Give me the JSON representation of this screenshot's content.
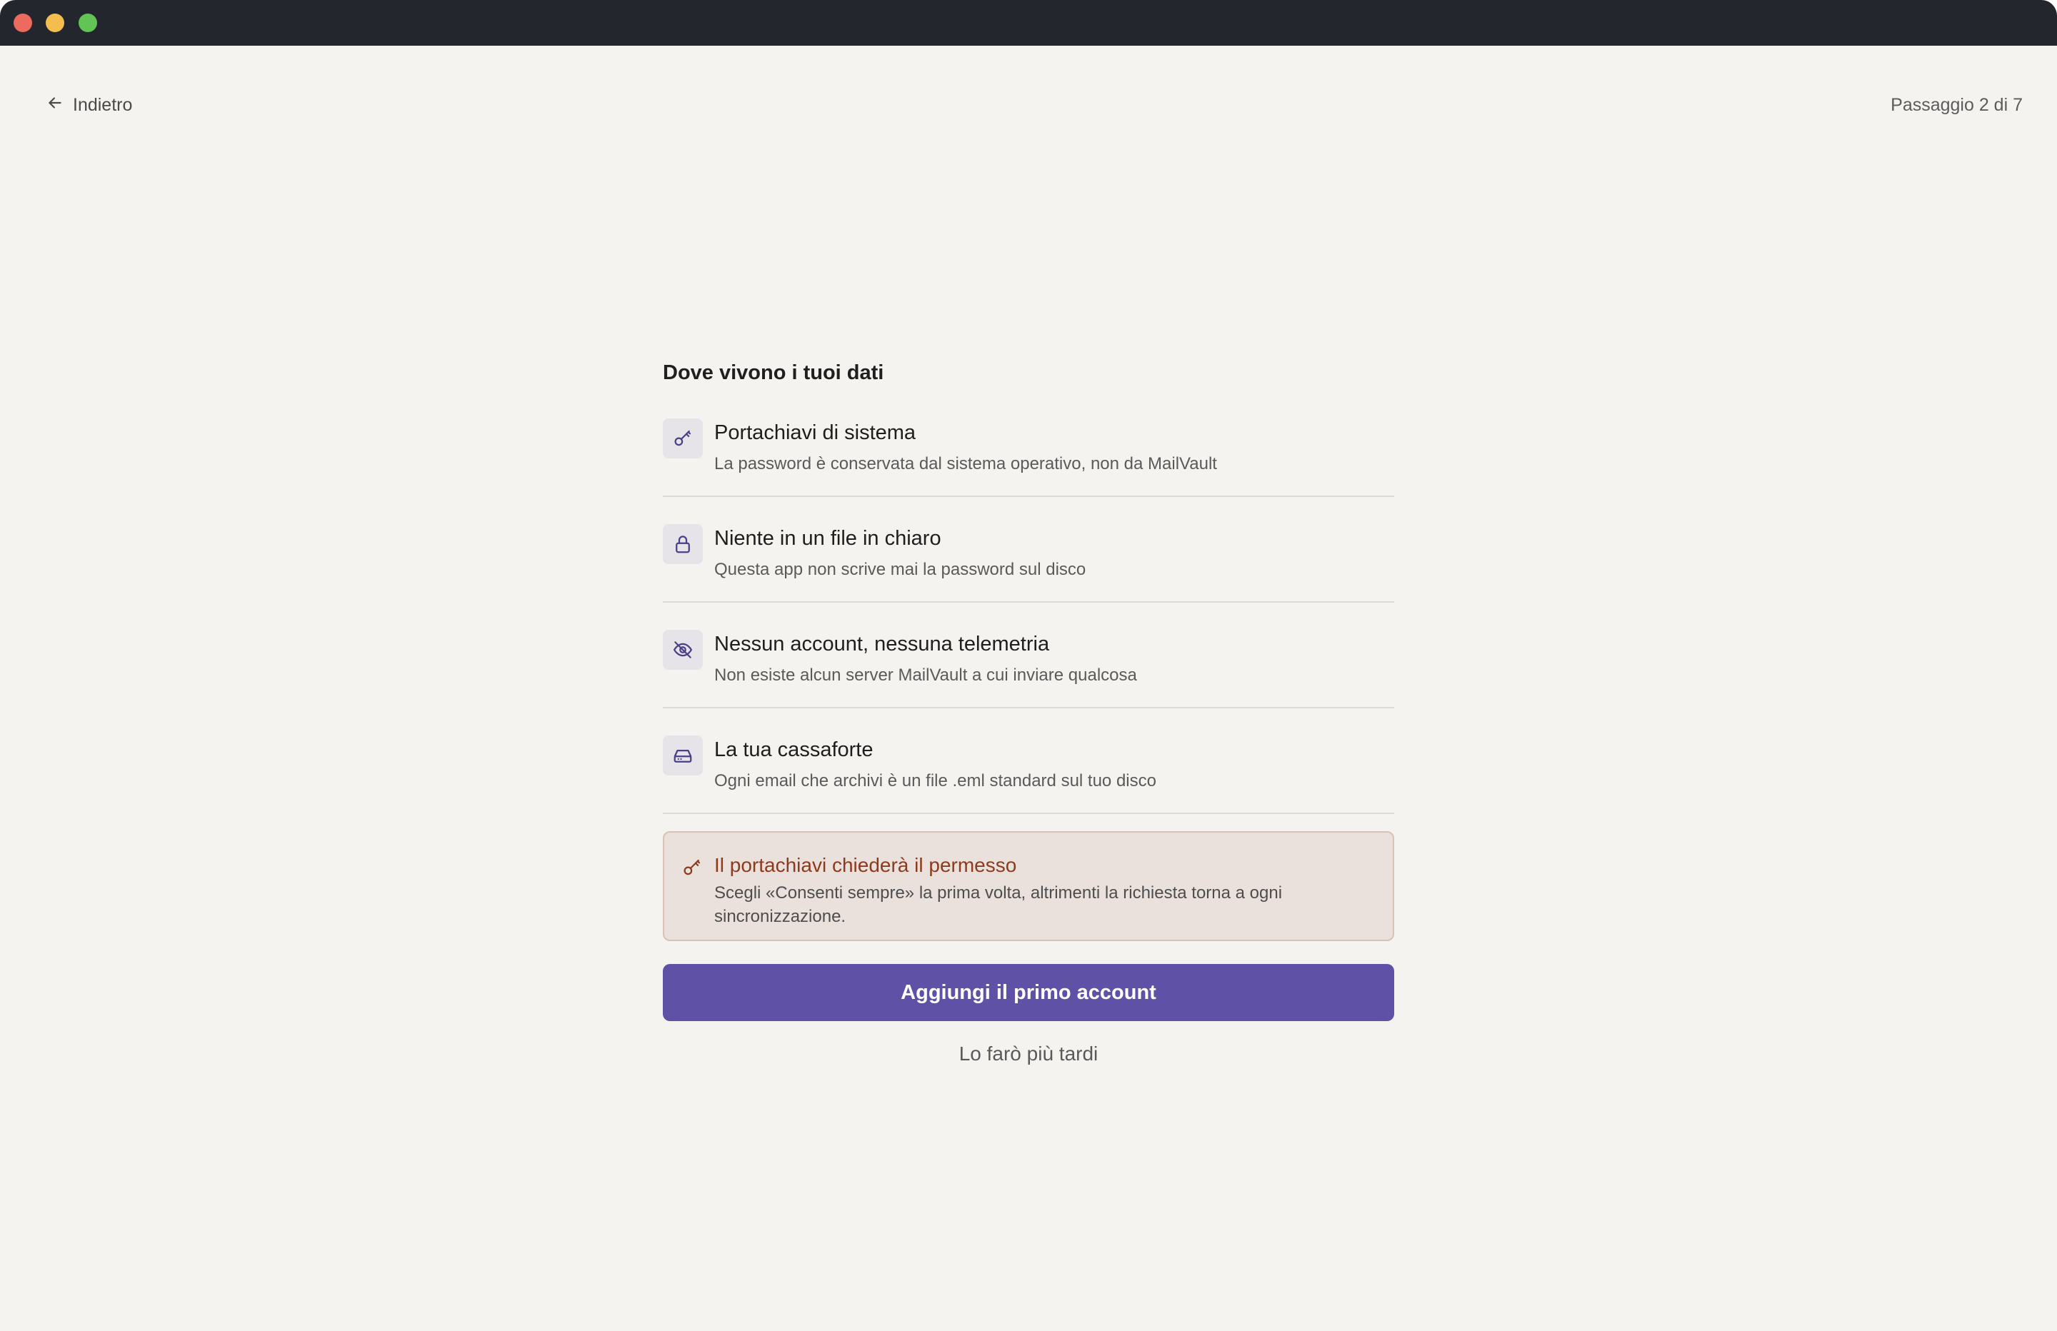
{
  "window": {
    "controls": {
      "close_color": "#ed6a5e",
      "minimize_color": "#f4be4f",
      "maximize_color": "#61c454"
    }
  },
  "header": {
    "back_label": "Indietro",
    "back_icon": "arrow-left-icon",
    "step_label": "Passaggio 2 di 7"
  },
  "main": {
    "section_title": "Dove vivono i tuoi dati",
    "features": [
      {
        "icon": "key-icon",
        "title": "Portachiavi di sistema",
        "description": "La password è conservata dal sistema operativo, non da MailVault"
      },
      {
        "icon": "lock-icon",
        "title": "Niente in un file in chiaro",
        "description": "Questa app non scrive mai la password sul disco"
      },
      {
        "icon": "eye-off-icon",
        "title": "Nessun account, nessuna telemetria",
        "description": "Non esiste alcun server MailVault a cui inviare qualcosa"
      },
      {
        "icon": "hard-drive-icon",
        "title": "La tua cassaforte",
        "description": "Ogni email che archivi è un file .eml standard sul tuo disco"
      }
    ],
    "notice": {
      "icon": "key-icon",
      "title": "Il portachiavi chiederà il permesso",
      "text": "Scegli «Consenti sempre» la prima volta, altrimenti la richiesta torna a ogni sincronizzazione."
    },
    "primary_button_label": "Aggiungi il primo account",
    "secondary_link_label": "Lo farò più tardi"
  },
  "colors": {
    "accent": "#5f52a6",
    "notice_title": "#8e3a1c",
    "notice_background": "#eae1dc",
    "background": "#f4f3ef"
  }
}
